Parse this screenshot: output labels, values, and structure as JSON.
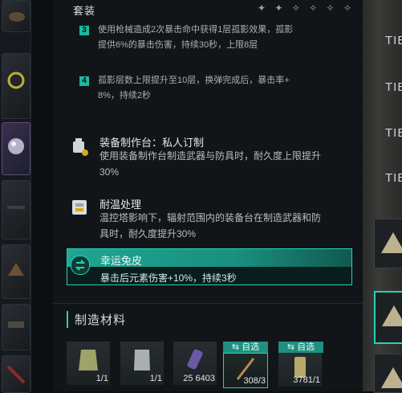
{
  "set": {
    "title": "套装",
    "stars": "✦ ✦ ✧ ✧ ✧ ✧",
    "effects": [
      {
        "num": "3",
        "lines": [
          "使用枪械造成2次暴击命中获得1层孤影效果，孤影",
          "提供6%的暴击伤害，持续30秒，上限8层"
        ]
      },
      {
        "num": "4",
        "lines": [
          "孤影层数上限提升至10层，换弹完成后，暴击率+",
          "8%，持续2秒"
        ]
      }
    ]
  },
  "skills": [
    {
      "title": "装备制作台：私人订制",
      "lines": [
        "使用装备制作台制造武器与防具时，耐久度上限提升",
        "30%"
      ],
      "icon": "workbench-icon"
    },
    {
      "title": "耐温处理",
      "lines": [
        "温控塔影响下，辐射范围内的装备台在制造武器和防",
        "具时，耐久度提升30%"
      ],
      "icon": "heat-resist-icon"
    }
  ],
  "highlight": {
    "title": "幸运兔皮",
    "desc": "暴击后元素伤害+10%，持续3秒",
    "icon": "swap-arrows-icon"
  },
  "materials": {
    "title": "制造材料",
    "items": [
      {
        "count": "1/1",
        "icon": "vest-icon"
      },
      {
        "count": "1/1",
        "icon": "armor-plate-icon"
      },
      {
        "count": "25  6403",
        "icon": "canister-icon"
      },
      {
        "count": "308/3",
        "icon": "rod-icon",
        "tag": "⇆ 自选"
      },
      {
        "count": "3781/1",
        "icon": "bundle-icon",
        "tag": "⇆ 自选"
      }
    ]
  },
  "right": {
    "tiers": [
      "TIE",
      "TIE",
      "TIE",
      "TIE"
    ]
  },
  "colors": {
    "accent": "#25d2b4",
    "panel": "#12161a"
  }
}
